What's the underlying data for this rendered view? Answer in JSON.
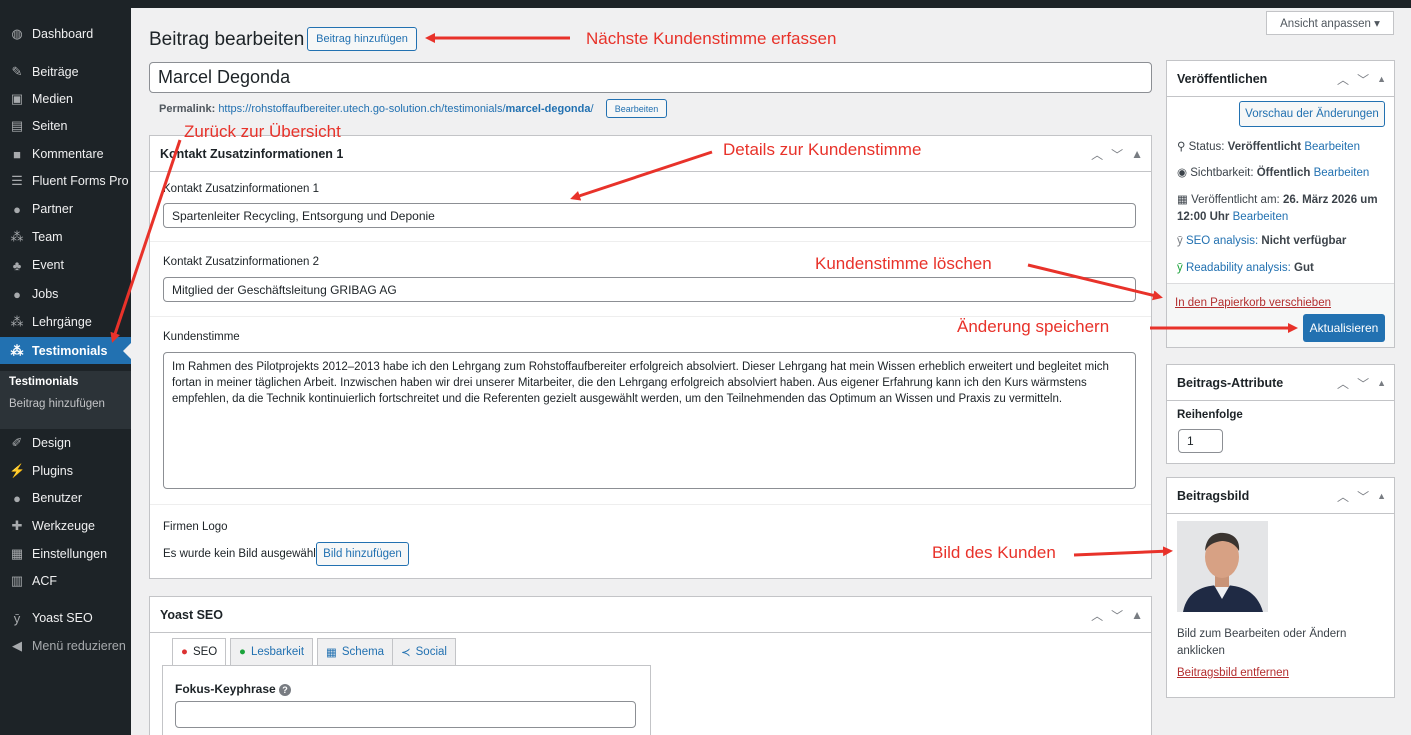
{
  "sidebar": {
    "items": [
      {
        "label": "Dashboard",
        "icon": "dashboard-icon"
      },
      {
        "label": "Beiträge",
        "icon": "pin-icon"
      },
      {
        "label": "Medien",
        "icon": "media-icon"
      },
      {
        "label": "Seiten",
        "icon": "page-icon"
      },
      {
        "label": "Kommentare",
        "icon": "comment-icon"
      },
      {
        "label": "Fluent Forms Pro",
        "icon": "form-icon"
      },
      {
        "label": "Partner",
        "icon": "user-icon"
      },
      {
        "label": "Team",
        "icon": "group-icon"
      },
      {
        "label": "Event",
        "icon": "sitemap-icon"
      },
      {
        "label": "Jobs",
        "icon": "user-icon"
      },
      {
        "label": "Lehrgänge",
        "icon": "group-icon"
      },
      {
        "label": "Testimonials",
        "icon": "group-icon"
      },
      {
        "label": "Design",
        "icon": "brush-icon"
      },
      {
        "label": "Plugins",
        "icon": "plug-icon"
      },
      {
        "label": "Benutzer",
        "icon": "user-icon"
      },
      {
        "label": "Werkzeuge",
        "icon": "wrench-icon"
      },
      {
        "label": "Einstellungen",
        "icon": "settings-icon"
      },
      {
        "label": "ACF",
        "icon": "acf-icon"
      },
      {
        "label": "Yoast SEO",
        "icon": "yoast-icon"
      },
      {
        "label": "Menü reduzieren",
        "icon": "collapse-icon"
      }
    ],
    "submenu": [
      "Testimonials",
      "Beitrag hinzufügen"
    ]
  },
  "screen_options": "Ansicht anpassen ▾",
  "header": {
    "title": "Beitrag bearbeiten",
    "add_button": "Beitrag hinzufügen"
  },
  "post": {
    "title": "Marcel Degonda",
    "permalink_label": "Permalink:",
    "permalink_base": "https://rohstoffaufbereiter.utech.go-solution.ch/testimonials/",
    "permalink_slug": "marcel-degonda",
    "permalink_end": "/",
    "permalink_edit": "Bearbeiten"
  },
  "contact_box": {
    "title": "Kontakt Zusatzinformationen 1",
    "field1_label": "Kontakt Zusatzinformationen 1",
    "field1_value": "Spartenleiter Recycling, Entsorgung und Deponie",
    "field2_label": "Kontakt Zusatzinformationen 2",
    "field2_value": "Mitglied der Geschäftsleitung GRIBAG AG",
    "testimonial_label": "Kundenstimme",
    "testimonial_text": "Im Rahmen des Pilotprojekts 2012–2013 habe ich den Lehrgang zum Rohstoffaufbereiter erfolgreich absolviert. Dieser Lehrgang hat mein Wissen erheblich erweitert und begleitet mich fortan in meiner täglichen Arbeit. Inzwischen haben wir drei unserer Mitarbeiter, die den Lehrgang erfolgreich absolviert haben. Aus eigener Erfahrung kann ich den Kurs wärmstens empfehlen, da die Technik kontinuierlich fortschreitet und die Referenten gezielt ausgewählt werden, um den Teilnehmenden das Optimum an Wissen und Praxis zu vermitteln.",
    "logo_label": "Firmen Logo",
    "logo_none": "Es wurde kein Bild ausgewählt",
    "logo_button": "Bild hinzufügen"
  },
  "yoast": {
    "title": "Yoast SEO",
    "tabs": [
      "SEO",
      "Lesbarkeit",
      "Schema",
      "Social"
    ],
    "keyphrase_label": "Fokus-Keyphrase"
  },
  "publish": {
    "title": "Veröffentlichen",
    "preview_button": "Vorschau der Änderungen",
    "status_label": "Status:",
    "status_value": "Veröffentlicht",
    "visibility_label": "Sichtbarkeit:",
    "visibility_value": "Öffentlich",
    "published_label": "Veröffentlicht am:",
    "published_value_1": "26. März 2026 um",
    "published_value_2": "12:00 Uhr",
    "edit": "Bearbeiten",
    "seo_link": "SEO analysis:",
    "seo_value": "Nicht verfügbar",
    "read_link": "Readability analysis:",
    "read_value": "Gut",
    "trash": "In den Papierkorb verschieben",
    "update": "Aktualisieren"
  },
  "attributes": {
    "title": "Beitrags-Attribute",
    "order_label": "Reihenfolge",
    "order_value": "1"
  },
  "featured": {
    "title": "Beitragsbild",
    "hint": "Bild zum Bearbeiten oder Ändern anklicken",
    "remove": "Beitragsbild entfernen"
  },
  "annotations": {
    "next": "Nächste Kundenstimme erfassen",
    "back": "Zurück zur Übersicht",
    "details": "Details zur Kundenstimme",
    "delete": "Kundenstimme löschen",
    "save": "Änderung speichern",
    "image": "Bild des Kunden"
  },
  "colors": {
    "accent": "#2271b1",
    "annotation": "#e8322a",
    "admin_bar": "#1d2327"
  }
}
